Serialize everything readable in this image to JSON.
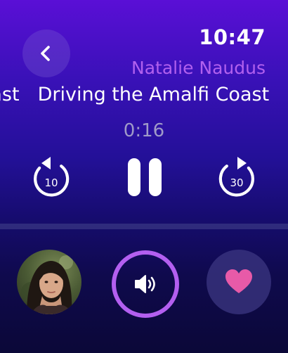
{
  "status": {
    "time": "10:47"
  },
  "track": {
    "artist": "Natalie Naudus",
    "title": "Driving the Amalfi Coast",
    "elapsed": "0:16"
  },
  "controls": {
    "rewind_seconds": "10",
    "forward_seconds": "30"
  },
  "icons": {
    "back": "chevron-left-icon",
    "rewind": "rewind-10-icon",
    "pause": "pause-icon",
    "forward": "forward-30-icon",
    "volume": "speaker-icon",
    "favorite": "heart-icon"
  },
  "colors": {
    "accent": "#b35ff0",
    "artist_text": "#b160ee",
    "heart": "#e85aa8",
    "elapsed_text": "#9f9ac8"
  }
}
